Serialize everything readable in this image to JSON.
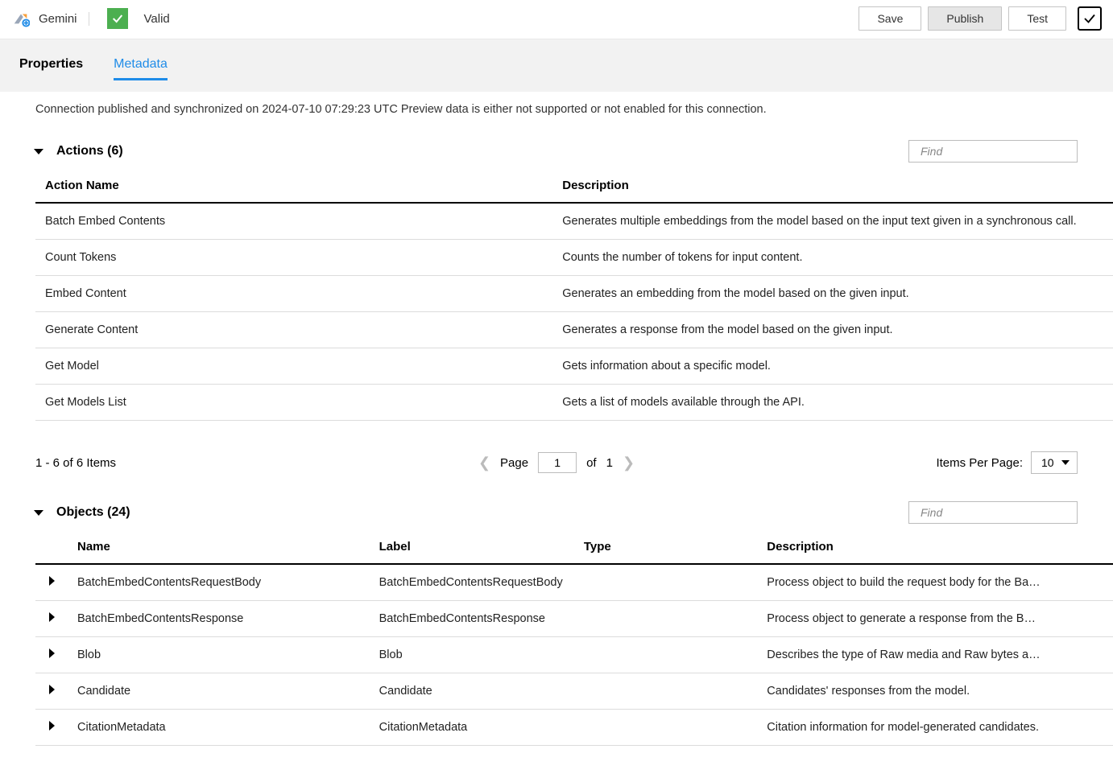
{
  "header": {
    "app_name": "Gemini",
    "valid_label": "Valid",
    "buttons": {
      "save": "Save",
      "publish": "Publish",
      "test": "Test"
    }
  },
  "tabs": {
    "properties": "Properties",
    "metadata": "Metadata"
  },
  "status_text": "Connection published and synchronized on 2024-07-10 07:29:23 UTC Preview data is either not supported or not enabled for this connection.",
  "actions": {
    "heading": "Actions (6)",
    "find_placeholder": "Find",
    "columns": {
      "name": "Action Name",
      "desc": "Description"
    },
    "rows": [
      {
        "name": "Batch Embed Contents",
        "desc": "Generates multiple embeddings from the model based on the input text given in a synchronous call."
      },
      {
        "name": "Count Tokens",
        "desc": "Counts the number of tokens for input content."
      },
      {
        "name": "Embed Content",
        "desc": "Generates an embedding from the model based on the given input."
      },
      {
        "name": "Generate Content",
        "desc": "Generates a response from the model based on the given input."
      },
      {
        "name": "Get Model",
        "desc": "Gets information about a specific model."
      },
      {
        "name": "Get Models List",
        "desc": "Gets a list of models available through the API."
      }
    ]
  },
  "pager": {
    "range_label": "1 - 6 of 6 Items",
    "page_label": "Page",
    "page_value": "1",
    "of_label": "of",
    "total_pages": "1",
    "ipp_label": "Items Per Page:",
    "ipp_value": "10"
  },
  "objects": {
    "heading": "Objects (24)",
    "find_placeholder": "Find",
    "columns": {
      "name": "Name",
      "label": "Label",
      "type": "Type",
      "desc": "Description"
    },
    "rows": [
      {
        "name": "BatchEmbedContentsRequestBody",
        "label": "BatchEmbedContentsRequestBody",
        "type": "",
        "desc": "Process object to build the request body for the Batch E..."
      },
      {
        "name": "BatchEmbedContentsResponse",
        "label": "BatchEmbedContentsResponse",
        "type": "",
        "desc": "Process object to generate a response from the Batch E..."
      },
      {
        "name": "Blob",
        "label": "Blob",
        "type": "",
        "desc": "Describes the type of Raw media and Raw bytes as stri..."
      },
      {
        "name": "Candidate",
        "label": "Candidate",
        "type": "",
        "desc": "Candidates' responses from the model."
      },
      {
        "name": "CitationMetadata",
        "label": "CitationMetadata",
        "type": "",
        "desc": "Citation information for model-generated candidates."
      }
    ]
  }
}
